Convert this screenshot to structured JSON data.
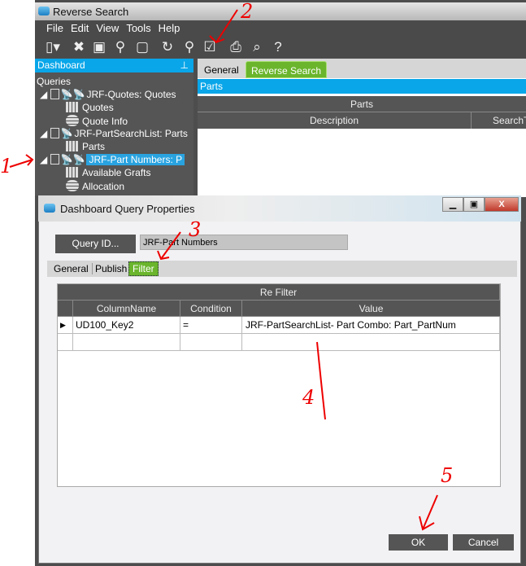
{
  "window": {
    "title": "Reverse Search"
  },
  "menu": [
    "File",
    "Edit",
    "View",
    "Tools",
    "Help"
  ],
  "toolbar_icons": [
    "new-icon",
    "delete-icon",
    "save-icon",
    "clear-icon",
    "note-icon",
    "refresh-icon",
    "broom-icon",
    "dashboard-properties-icon",
    "print-icon",
    "print-preview-icon",
    "help-icon"
  ],
  "dashboard": {
    "title": "Dashboard",
    "root": "Queries",
    "items": [
      "JRF-Quotes: Quotes",
      "Quotes",
      "Quote Info",
      "JRF-PartSearchList: Parts",
      "Parts",
      "JRF-Part Numbers: P",
      "Available Grafts",
      "Allocation"
    ]
  },
  "main": {
    "tabs": [
      "General",
      "Reverse Search"
    ],
    "panel_title": "Parts",
    "grid_title": "Parts",
    "columns": [
      "Description",
      "SearchT"
    ]
  },
  "dialog": {
    "title": "Dashboard Query Properties",
    "query_id_label": "Query ID...",
    "query_id_value": "JRF-Part Numbers",
    "tabs": [
      "General",
      "Publish",
      "Filter"
    ],
    "active_tab": "Filter",
    "grid": {
      "title": "Re Filter",
      "columns": [
        "ColumnName",
        "Condition",
        "Value"
      ],
      "rows": [
        [
          "UD100_Key2",
          "=",
          "JRF-PartSearchList- Part Combo: Part_PartNum"
        ]
      ]
    },
    "ok": "OK",
    "cancel": "Cancel"
  },
  "annotations": [
    "1",
    "2",
    "3",
    "4",
    "5"
  ],
  "colors": {
    "accent_blue": "#09a6e9",
    "active_tab_green": "#6ab52c",
    "annotation_red": "#e00000"
  }
}
